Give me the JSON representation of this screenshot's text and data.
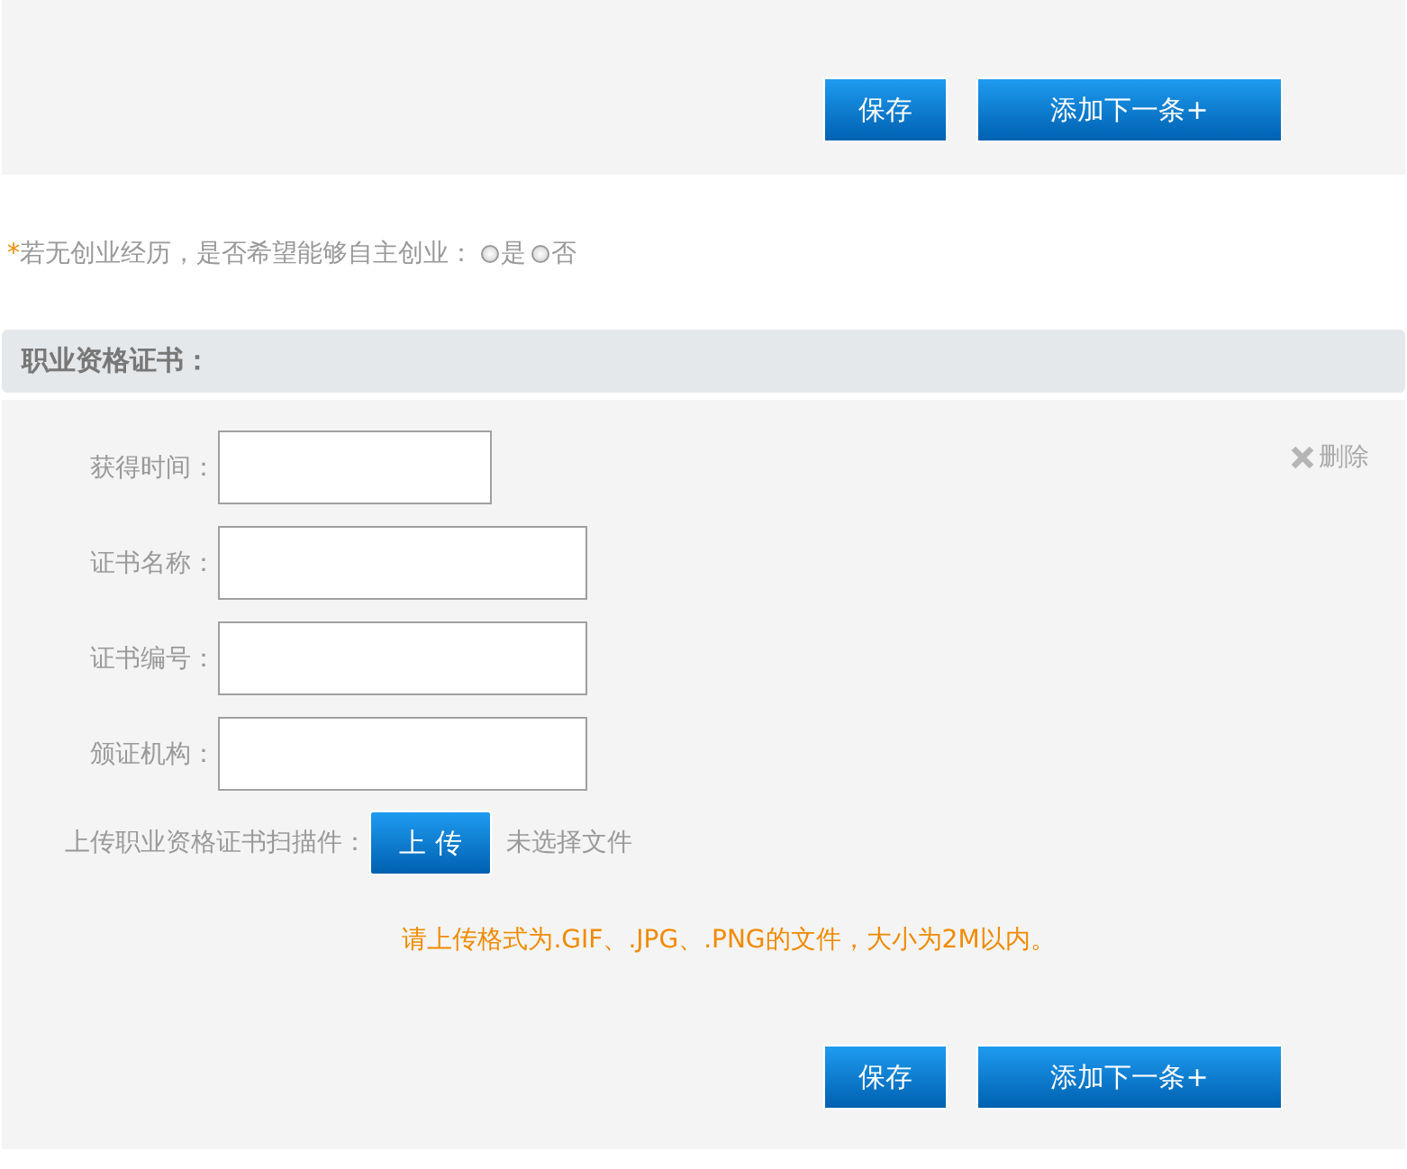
{
  "top_panel": {
    "buttons": [
      {
        "kind": "save",
        "label": "保存"
      },
      {
        "kind": "add",
        "label": "添加下一条+"
      }
    ]
  },
  "question": {
    "required_mark": "*",
    "text": "若无创业经历，是否希望能够自主创业：",
    "options": [
      {
        "label": "是",
        "selected": false
      },
      {
        "label": "否",
        "selected": false
      }
    ]
  },
  "section": {
    "title": "职业资格证书：",
    "delete_label": "删除",
    "fields": [
      {
        "label": "获得时间："
      },
      {
        "label": "证书名称："
      },
      {
        "label": "证书编号："
      },
      {
        "label": "颁证机构："
      }
    ],
    "upload": {
      "label": "上传职业资格证书扫描件：",
      "button": "上 传",
      "status": "未选择文件"
    },
    "notice": "请上传格式为.GIF、.JPG、.PNG的文件，大小为2M以内。",
    "buttons": [
      {
        "kind": "save",
        "label": "保存"
      },
      {
        "kind": "add",
        "label": "添加下一条+"
      }
    ]
  }
}
